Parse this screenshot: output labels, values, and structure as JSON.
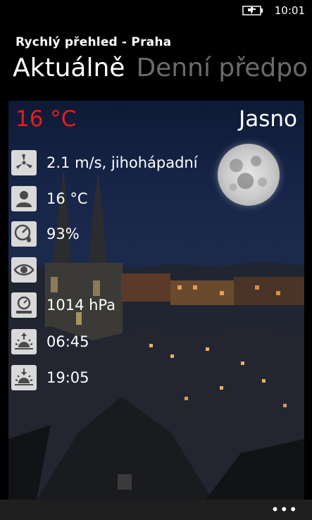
{
  "status_bar": {
    "time": "10:01",
    "battery_icon": "battery-charging-icon"
  },
  "header": {
    "app_title": "Rychlý přehled - Praha",
    "pivot": [
      {
        "label": "Aktuálně",
        "active": true
      },
      {
        "label": "Denní předpo",
        "active": false
      }
    ]
  },
  "current": {
    "temperature": "16 °C",
    "condition": "Jasno",
    "temperature_color": "#e51d1d",
    "rows": [
      {
        "icon": "wind-turbine-icon",
        "value": "2.1 m/s, jihohápadní"
      },
      {
        "icon": "person-feels-like-icon",
        "value": "16 °C"
      },
      {
        "icon": "humidity-gauge-icon",
        "value": "93%"
      },
      {
        "icon": "eye-visibility-icon",
        "value": ""
      },
      {
        "icon": "pressure-barometer-icon",
        "value": "1014 hPa"
      },
      {
        "icon": "sunrise-icon",
        "value": "06:45"
      },
      {
        "icon": "sunset-icon",
        "value": "19:05"
      }
    ]
  },
  "app_bar": {
    "more_label": "•••"
  }
}
